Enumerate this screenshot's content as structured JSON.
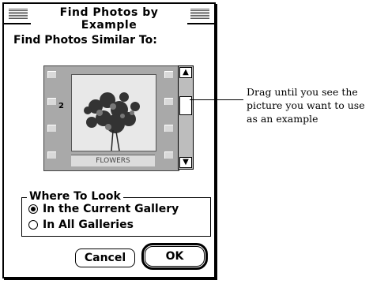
{
  "dialog": {
    "title": "Find Photos by Example",
    "subhead": "Find Photos Similar To:"
  },
  "film": {
    "frame_number": "2",
    "caption": "FLOWERS"
  },
  "callout": {
    "text": "Drag until you see the picture you want to use as an example"
  },
  "where_to_look": {
    "label": "Where To Look",
    "options": [
      {
        "label": "In the Current Gallery",
        "selected": true
      },
      {
        "label": "In All Galleries",
        "selected": false
      }
    ]
  },
  "buttons": {
    "cancel": "Cancel",
    "ok": "OK"
  }
}
